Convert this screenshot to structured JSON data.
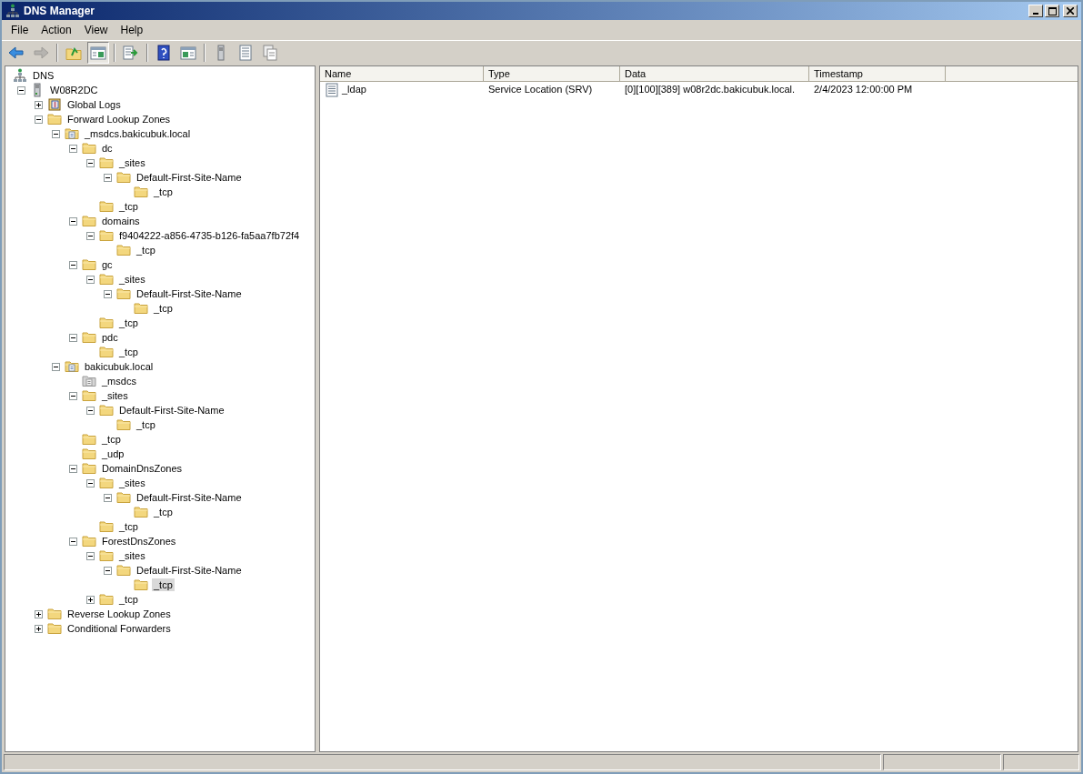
{
  "window": {
    "title": "DNS Manager"
  },
  "menu": [
    "File",
    "Action",
    "View",
    "Help"
  ],
  "toolbar": [
    {
      "kind": "back",
      "disabled": false,
      "pressed": false
    },
    {
      "kind": "forward",
      "disabled": true,
      "pressed": false
    },
    {
      "kind": "separator"
    },
    {
      "kind": "up",
      "disabled": false,
      "pressed": false
    },
    {
      "kind": "console-tree",
      "disabled": false,
      "pressed": true
    },
    {
      "kind": "separator"
    },
    {
      "kind": "export",
      "disabled": false,
      "pressed": false
    },
    {
      "kind": "separator"
    },
    {
      "kind": "help",
      "disabled": false,
      "pressed": false
    },
    {
      "kind": "action-pane",
      "disabled": false,
      "pressed": false
    },
    {
      "kind": "separator"
    },
    {
      "kind": "server",
      "disabled": false,
      "pressed": false
    },
    {
      "kind": "list",
      "disabled": false,
      "pressed": false
    },
    {
      "kind": "copy",
      "disabled": false,
      "pressed": false
    }
  ],
  "tree": [
    {
      "label": "DNS",
      "kind": "dns",
      "selected": false,
      "children": [
        {
          "label": "W08R2DC",
          "kind": "server",
          "expanded": true,
          "selected": false,
          "children": [
            {
              "label": "Global Logs",
              "kind": "logs",
              "expanded": false,
              "selected": false
            },
            {
              "label": "Forward Lookup Zones",
              "kind": "folder",
              "expanded": true,
              "selected": false,
              "children": [
                {
                  "label": "_msdcs.bakicubuk.local",
                  "kind": "zone",
                  "expanded": true,
                  "selected": false,
                  "children": [
                    {
                      "label": "dc",
                      "kind": "folder",
                      "expanded": true,
                      "selected": false,
                      "children": [
                        {
                          "label": "_sites",
                          "kind": "folder",
                          "expanded": true,
                          "selected": false,
                          "children": [
                            {
                              "label": "Default-First-Site-Name",
                              "kind": "folder",
                              "expanded": true,
                              "selected": false,
                              "children": [
                                {
                                  "label": "_tcp",
                                  "kind": "folder",
                                  "selected": false
                                }
                              ]
                            }
                          ]
                        },
                        {
                          "label": "_tcp",
                          "kind": "folder",
                          "selected": false
                        }
                      ]
                    },
                    {
                      "label": "domains",
                      "kind": "folder",
                      "expanded": true,
                      "selected": false,
                      "children": [
                        {
                          "label": "f9404222-a856-4735-b126-fa5aa7fb72f4",
                          "kind": "folder",
                          "expanded": true,
                          "selected": false,
                          "children": [
                            {
                              "label": "_tcp",
                              "kind": "folder",
                              "selected": false
                            }
                          ]
                        }
                      ]
                    },
                    {
                      "label": "gc",
                      "kind": "folder",
                      "expanded": true,
                      "selected": false,
                      "children": [
                        {
                          "label": "_sites",
                          "kind": "folder",
                          "expanded": true,
                          "selected": false,
                          "children": [
                            {
                              "label": "Default-First-Site-Name",
                              "kind": "folder",
                              "expanded": true,
                              "selected": false,
                              "children": [
                                {
                                  "label": "_tcp",
                                  "kind": "folder",
                                  "selected": false
                                }
                              ]
                            }
                          ]
                        },
                        {
                          "label": "_tcp",
                          "kind": "folder",
                          "selected": false
                        }
                      ]
                    },
                    {
                      "label": "pdc",
                      "kind": "folder",
                      "expanded": true,
                      "selected": false,
                      "children": [
                        {
                          "label": "_tcp",
                          "kind": "folder",
                          "selected": false
                        }
                      ]
                    }
                  ]
                },
                {
                  "label": "bakicubuk.local",
                  "kind": "zone",
                  "expanded": true,
                  "selected": false,
                  "children": [
                    {
                      "label": "_msdcs",
                      "kind": "delegation",
                      "selected": false
                    },
                    {
                      "label": "_sites",
                      "kind": "folder",
                      "expanded": true,
                      "selected": false,
                      "children": [
                        {
                          "label": "Default-First-Site-Name",
                          "kind": "folder",
                          "expanded": true,
                          "selected": false,
                          "children": [
                            {
                              "label": "_tcp",
                              "kind": "folder",
                              "selected": false
                            }
                          ]
                        }
                      ]
                    },
                    {
                      "label": "_tcp",
                      "kind": "folder",
                      "selected": false
                    },
                    {
                      "label": "_udp",
                      "kind": "folder",
                      "selected": false
                    },
                    {
                      "label": "DomainDnsZones",
                      "kind": "folder",
                      "expanded": true,
                      "selected": false,
                      "children": [
                        {
                          "label": "_sites",
                          "kind": "folder",
                          "expanded": true,
                          "selected": false,
                          "children": [
                            {
                              "label": "Default-First-Site-Name",
                              "kind": "folder",
                              "expanded": true,
                              "selected": false,
                              "children": [
                                {
                                  "label": "_tcp",
                                  "kind": "folder",
                                  "selected": false
                                }
                              ]
                            }
                          ]
                        },
                        {
                          "label": "_tcp",
                          "kind": "folder",
                          "selected": false
                        }
                      ]
                    },
                    {
                      "label": "ForestDnsZones",
                      "kind": "folder",
                      "expanded": true,
                      "selected": false,
                      "children": [
                        {
                          "label": "_sites",
                          "kind": "folder",
                          "expanded": true,
                          "selected": false,
                          "children": [
                            {
                              "label": "Default-First-Site-Name",
                              "kind": "folder",
                              "expanded": true,
                              "selected": false,
                              "children": [
                                {
                                  "label": "_tcp",
                                  "kind": "folder",
                                  "selected": true
                                }
                              ]
                            }
                          ]
                        },
                        {
                          "label": "_tcp",
                          "kind": "folder",
                          "expanded": false,
                          "selected": false
                        }
                      ]
                    }
                  ]
                }
              ]
            },
            {
              "label": "Reverse Lookup Zones",
              "kind": "folder",
              "expanded": false,
              "selected": false
            },
            {
              "label": "Conditional Forwarders",
              "kind": "folder",
              "expanded": false,
              "selected": false
            }
          ]
        }
      ]
    }
  ],
  "list": {
    "columns": [
      "Name",
      "Type",
      "Data",
      "Timestamp"
    ],
    "rows": [
      {
        "cells": [
          "_ldap",
          "Service Location (SRV)",
          "[0][100][389] w08r2dc.bakicubuk.local.",
          "2/4/2023 12:00:00 PM"
        ]
      }
    ]
  }
}
